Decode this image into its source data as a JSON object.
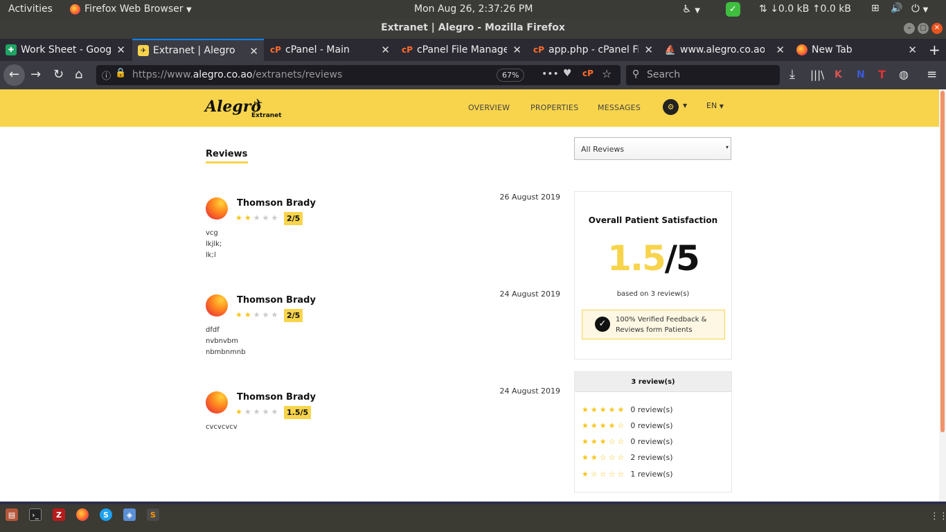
{
  "system": {
    "activities": "Activities",
    "app_menu": "Firefox Web Browser",
    "clock": "Mon Aug 26,  2:37:26 PM",
    "net_down": "↓0.0 kB",
    "net_up": "↑0.0 kB"
  },
  "window": {
    "title": "Extranet | Alegro - Mozilla Firefox"
  },
  "tabs": [
    {
      "label": "Work Sheet - Google Sheets",
      "favicon": "sheets-icon",
      "color": "#1fa463"
    },
    {
      "label": "Extranet | Alegro",
      "favicon": "alegro-icon",
      "color": "#f7d44c",
      "active": true
    },
    {
      "label": "cPanel - Main",
      "favicon": "cpanel-icon",
      "color": "#ff6c2c"
    },
    {
      "label": "cPanel File Manager",
      "favicon": "cpanel-icon",
      "color": "#ff6c2c"
    },
    {
      "label": "app.php - cPanel File Manager",
      "favicon": "cpanel-icon",
      "color": "#ff6c2c"
    },
    {
      "label": "www.alegro.co.ao / localhost",
      "favicon": "phpmyadmin-icon",
      "color": "#e8a33d"
    },
    {
      "label": "New Tab",
      "favicon": "firefox-icon",
      "color": "#ff7139"
    }
  ],
  "navbar": {
    "url_prefix": "https://www.",
    "url_domain": "alegro.co.ao",
    "url_path": "/extranets/reviews",
    "zoom": "67%",
    "search_placeholder": "Search"
  },
  "site": {
    "logo": "Alegro",
    "logo_sub": "Extranet",
    "nav": [
      "OVERVIEW",
      "PROPERTIES",
      "MESSAGES"
    ],
    "lang": "EN"
  },
  "page": {
    "title": "Reviews",
    "filter_selected": "All Reviews"
  },
  "reviews": [
    {
      "name": "Thomson Brady",
      "date": "26 August 2019",
      "rating": 2,
      "badge": "2/5",
      "lines": [
        "vcg",
        "lkjlk;",
        "lk;l"
      ]
    },
    {
      "name": "Thomson Brady",
      "date": "24 August 2019",
      "rating": 2,
      "badge": "2/5",
      "lines": [
        "dfdf",
        "nvbnvbm",
        "nbmbnmnb"
      ]
    },
    {
      "name": "Thomson Brady",
      "date": "24 August 2019",
      "rating": 1,
      "badge": "1.5/5",
      "lines": [
        "cvcvcvcv"
      ]
    }
  ],
  "satisfaction": {
    "heading": "Overall Patient Satisfaction",
    "score": "1.5",
    "out_of": "/5",
    "based_on": "based on 3 review(s)",
    "verified": "100% Verified Feedback & Reviews form Patients"
  },
  "distribution": {
    "total": "3 review(s)",
    "rows": [
      {
        "stars": 5,
        "count": "0 review(s)"
      },
      {
        "stars": 4,
        "count": "0 review(s)"
      },
      {
        "stars": 3,
        "count": "0 review(s)"
      },
      {
        "stars": 2,
        "count": "2 review(s)"
      },
      {
        "stars": 1,
        "count": "1 review(s)"
      }
    ]
  },
  "colors": {
    "accent": "#f7d44c",
    "star": "#f5c518",
    "star_off": "#c9c9c9"
  }
}
